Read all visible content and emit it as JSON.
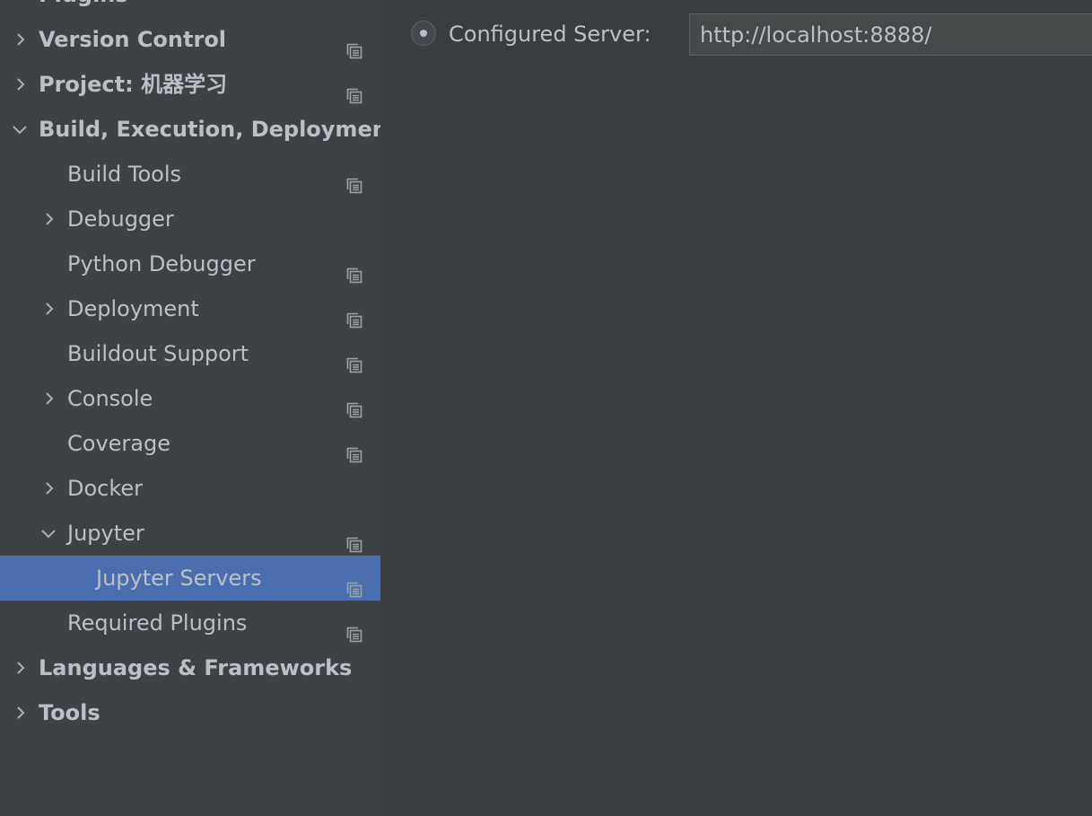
{
  "sidebar": {
    "items": [
      {
        "label": "Plugins",
        "depth": 0,
        "bold": true,
        "expander": "none",
        "icon": false
      },
      {
        "label": "Version Control",
        "depth": 0,
        "bold": true,
        "expander": "collapsed",
        "icon": true
      },
      {
        "label": "Project: 机器学习",
        "depth": 0,
        "bold": true,
        "expander": "collapsed",
        "icon": true
      },
      {
        "label": "Build, Execution, Deployment",
        "depth": 0,
        "bold": true,
        "expander": "expanded",
        "icon": false
      },
      {
        "label": "Build Tools",
        "depth": 1,
        "bold": false,
        "expander": "none",
        "icon": true
      },
      {
        "label": "Debugger",
        "depth": 1,
        "bold": false,
        "expander": "collapsed",
        "icon": false
      },
      {
        "label": "Python Debugger",
        "depth": 1,
        "bold": false,
        "expander": "none",
        "icon": true
      },
      {
        "label": "Deployment",
        "depth": 1,
        "bold": false,
        "expander": "collapsed",
        "icon": true
      },
      {
        "label": "Buildout Support",
        "depth": 1,
        "bold": false,
        "expander": "none",
        "icon": true
      },
      {
        "label": "Console",
        "depth": 1,
        "bold": false,
        "expander": "collapsed",
        "icon": true
      },
      {
        "label": "Coverage",
        "depth": 1,
        "bold": false,
        "expander": "none",
        "icon": true
      },
      {
        "label": "Docker",
        "depth": 1,
        "bold": false,
        "expander": "collapsed",
        "icon": false
      },
      {
        "label": "Jupyter",
        "depth": 1,
        "bold": false,
        "expander": "expanded",
        "icon": true
      },
      {
        "label": "Jupyter Servers",
        "depth": 2,
        "bold": false,
        "expander": "none",
        "icon": true,
        "selected": true
      },
      {
        "label": "Required Plugins",
        "depth": 1,
        "bold": false,
        "expander": "none",
        "icon": true
      },
      {
        "label": "Languages & Frameworks",
        "depth": 0,
        "bold": true,
        "expander": "collapsed",
        "icon": false
      },
      {
        "label": "Tools",
        "depth": 0,
        "bold": true,
        "expander": "collapsed",
        "icon": false
      }
    ]
  },
  "main": {
    "configured_server_label": "Configured Server:",
    "configured_server_selected": true,
    "server_url": "http://localhost:8888/"
  },
  "colors": {
    "selection": "#4b6eaf",
    "text": "#bbc0c6",
    "sidebar_bg": "#3e4247",
    "main_bg": "#3a3d40"
  },
  "icons": {
    "collapsed": "chevron-right-icon",
    "expanded": "chevron-down-icon",
    "project_level": "project-settings-icon",
    "radio": "radio-button-icon"
  }
}
